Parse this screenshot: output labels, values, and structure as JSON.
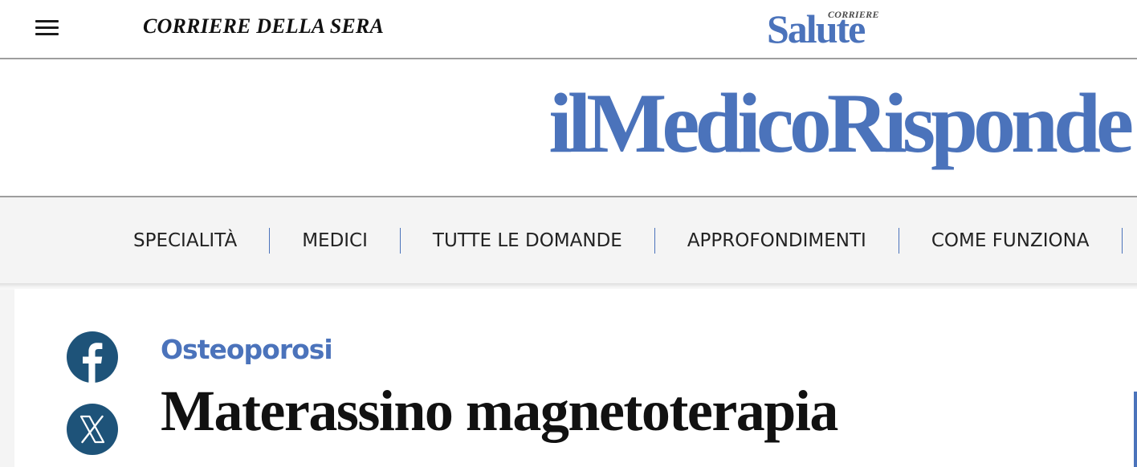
{
  "header": {
    "corriere_logo": "CORRIERE DELLA SERA",
    "salute_logo": {
      "main": "Salute",
      "small": "CORRIERE"
    }
  },
  "masthead": {
    "title": "ilMedicoRisponde"
  },
  "nav": {
    "items": [
      {
        "label": "SPECIALITÀ"
      },
      {
        "label": "MEDICI"
      },
      {
        "label": "TUTTE LE DOMANDE"
      },
      {
        "label": "APPROFONDIMENTI"
      },
      {
        "label": "COME FUNZIONA"
      }
    ]
  },
  "article": {
    "category": "Osteoporosi",
    "title": "Materassino magnetoterapia"
  },
  "social": {
    "icons": [
      "facebook-icon",
      "x-icon"
    ]
  },
  "colors": {
    "brand_blue": "#4b73bb",
    "social_bg": "#1e5379",
    "nav_bg": "#f4f4f4",
    "text": "#111111"
  }
}
